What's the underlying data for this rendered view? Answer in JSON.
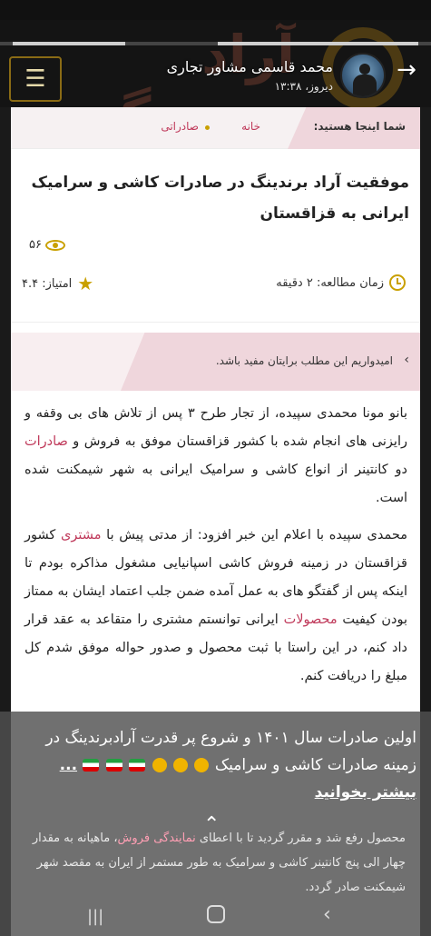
{
  "header": {
    "brand_watermark": "آراد برندینگ",
    "author_name": "محمد قاسمی مشاور تجاری",
    "author_date": "دیروز، ۱۳:۳۸",
    "back_icon": "arrow-right-icon",
    "menu_icon": "list-icon"
  },
  "breadcrumb": {
    "label": "شما اینجا هستید:",
    "home": "خانه",
    "category": "صادراتی"
  },
  "article": {
    "title": "موفقیت آراد برندینگ در صادرات کاشی و سرامیک ایرانی به قزاقستان",
    "views": "۵۶",
    "read_time": "زمان مطالعه: ۲ دقیقه",
    "rating": "امتیاز: ۴.۴",
    "note": "امیدواریم این مطلب برایتان مفید باشد.",
    "p1_a": "بانو مونا محمدی سپیده، از تجار طرح ۳ پس از تلاش های بی وقفه و رایزنی های انجام شده با کشور قزاقستان موفق به فروش و ",
    "p1_link": "صادرات",
    "p1_b": " دو کانتینر از انواع کاشی و سرامیک ایرانی به شهر شیمکنت شده است.",
    "p2_a": "محمدی سپیده با اعلام این خبر افزود: از مدتی پیش با ",
    "p2_link1": "مشتری",
    "p2_b": " کشور قزاقستان در زمینه فروش کاشی اسپانیایی مشغول مذاکره بودم تا اینکه پس از گفتگو های به عمل آمده ضمن جلب اعتماد ایشان به ممتاز بودن کیفیت ",
    "p2_link2": "محصولات",
    "p2_c": " ایرانی توانستم مشتری را متقاعد به عقد قرار داد کنم، در این راستا با ثبت محصول و صدور حواله موفق شدم کل مبلغ را دریافت کنم."
  },
  "toast": {
    "line": "اولین صادرات سال ۱۴۰۱ و شروع پر قدرت آرادبرندینگ در زمینه صادرات کاشی و سرامیک",
    "more": "... بیشتر بخوانید",
    "under_a": "محصول رفع شد و مقرر گردید تا با اعطای ",
    "under_link": "نمایندگی فروش",
    "under_b": "، ماهیانه به مقدار چهار الی پنج کانتینر کاشی و سرامیک به طور مستمر از ایران به مقصد شهر شیمکنت صادر گردد."
  },
  "colors": {
    "accent_gold": "#c9a000",
    "link_pink": "#c03a5b",
    "breadcrumb_pink": "#efd6dc"
  }
}
